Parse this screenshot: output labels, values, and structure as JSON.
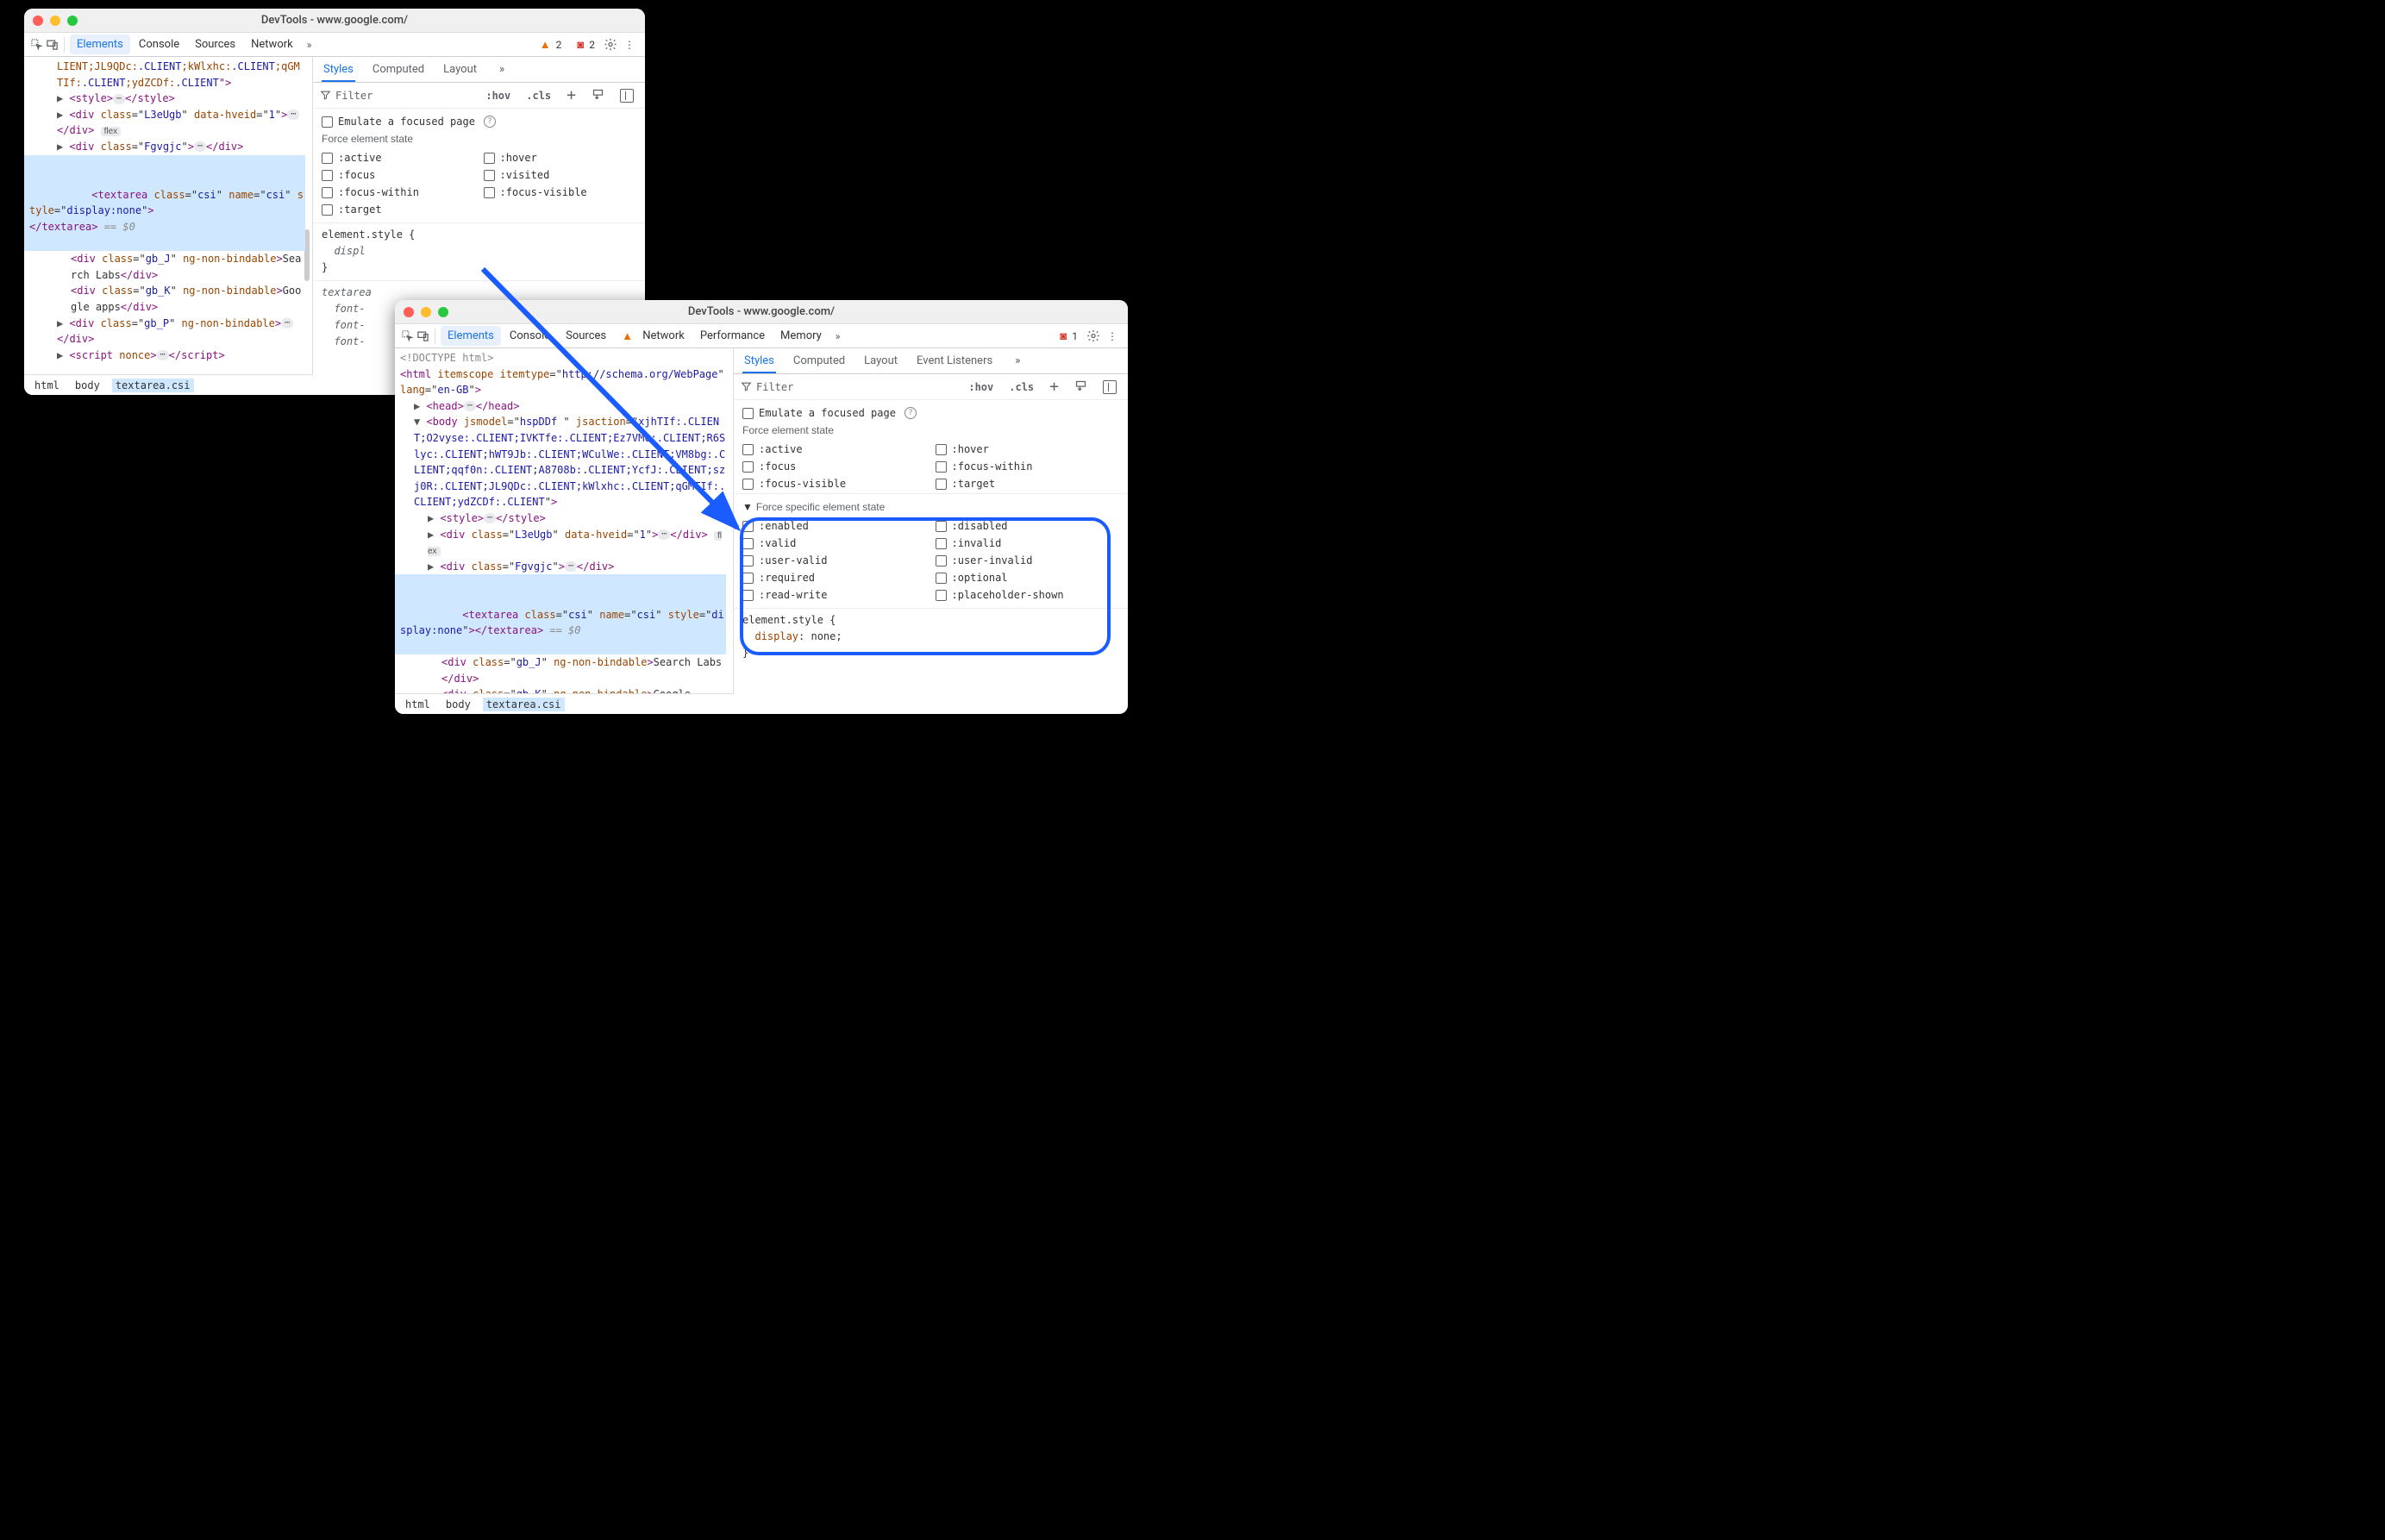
{
  "win1": {
    "title": "DevTools - www.google.com/",
    "tabs": [
      "Elements",
      "Console",
      "Sources",
      "Network"
    ],
    "warn_count": "2",
    "issue_count": "2",
    "crumbs": [
      "html",
      "body",
      "textarea.csi"
    ],
    "dom": {
      "l0": "LIENT;JL9QDc:.CLIENT;kWlxhc:.CLIENT;qGMTIf:.CLIENT;ydZCDf:.CLIENT\">",
      "l1a": "<style>",
      "l1b": "</style>",
      "l2a": "<div class=\"L3eUgb\" data-hveid=\"1\">",
      "l2b": "</div>",
      "flex": "flex",
      "l3a": "<div class=\"Fgvgjc\">",
      "l3b": "</div>",
      "sel_a": "<textarea class=\"csi\" name=\"csi\" style=\"display:none\">",
      "sel_b": "</textarea>",
      "eq": " == $0",
      "l5": "<div class=\"gb_J\" ng-non-bindable>Search Labs</div>",
      "l6": "<div class=\"gb_K\" ng-non-bindable>Google apps</div>",
      "l7a": "<div class=\"gb_P\" ng-non-bindable>",
      "l7b": "</div>",
      "l8a": "<script nonce>",
      "l8b": "</script>"
    },
    "styles": {
      "sub_tabs": [
        "Styles",
        "Computed",
        "Layout"
      ],
      "filter_ph": "Filter",
      "hov": ":hov",
      "cls": ".cls",
      "emulate": "Emulate a focused page",
      "force": "Force element state",
      "states_l": [
        ":active",
        ":focus",
        ":focus-within",
        ":target"
      ],
      "states_r": [
        ":hover",
        ":visited",
        ":focus-visible"
      ],
      "elstyle_open": "element.style {",
      "elstyle_prop": "  displ",
      "elstyle_close": "}",
      "rule2_sel": "textarea",
      "rule2_lines": [
        "  font-",
        "  font-",
        "  font-"
      ]
    }
  },
  "win2": {
    "title": "DevTools - www.google.com/",
    "tabs": [
      "Elements",
      "Console",
      "Sources",
      "Network",
      "Performance",
      "Memory"
    ],
    "issue_count": "1",
    "crumbs": [
      "html",
      "body",
      "textarea.csi"
    ],
    "dom": {
      "doctype": "<!DOCTYPE html>",
      "html": "<html itemscope itemtype=\"http://schema.org/WebPage\" lang=\"en-GB\">",
      "head_a": "<head>",
      "head_b": "</head>",
      "body_open": "<body jsmodel=\"hspDDf \" jsaction=\"xjhTIf:.CLIENT;O2vyse:.CLIENT;IVKTfe:.CLIENT;Ez7VMc:.CLIENT;R6Slyc:.CLIENT;hWT9Jb:.CLIENT;WCulWe:.CLIENT;VM8bg:.CLIENT;qqf0n:.CLIENT;A87Qbb:.CLIENT;YcfJ:.CLIENT;szj0R:.CLIENT;JL9QDc:.CLIENT;kWlxhc:.CLIENT;qGMTIf:.CLIENT;ydZCDf:.CLIENT\">",
      "style_a": "<style>",
      "style_b": "</style>",
      "div1": "<div class=\"L3eUgb\" data-hveid=\"1\">",
      "div1_b": "</div>",
      "flex": "flex",
      "div2": "<div class=\"Fgvgjc\">",
      "div2_b": "</div>",
      "sel": "<textarea class=\"csi\" name=\"csi\" style=\"display:none\"></textarea>",
      "eq": " == $0",
      "div3": "<div class=\"gb_J\" ng-non-bindable>Search Labs</div>",
      "div4": "<div class=\"gb_K\" ng-non-bindable>Google"
    },
    "styles": {
      "sub_tabs": [
        "Styles",
        "Computed",
        "Layout",
        "Event Listeners"
      ],
      "filter_ph": "Filter",
      "hov": ":hov",
      "cls": ".cls",
      "emulate": "Emulate a focused page",
      "force": "Force element state",
      "states_l": [
        ":active",
        ":focus",
        ":focus-visible"
      ],
      "states_r": [
        ":hover",
        ":focus-within",
        ":target"
      ],
      "spec_title": "Force specific element state",
      "spec_l": [
        ":enabled",
        ":valid",
        ":user-valid",
        ":required",
        ":read-write"
      ],
      "spec_r": [
        ":disabled",
        ":invalid",
        ":user-invalid",
        ":optional",
        ":placeholder-shown"
      ],
      "elstyle_open": "element.style {",
      "prop": "display",
      "val": "none",
      "elstyle_close": "}"
    }
  }
}
